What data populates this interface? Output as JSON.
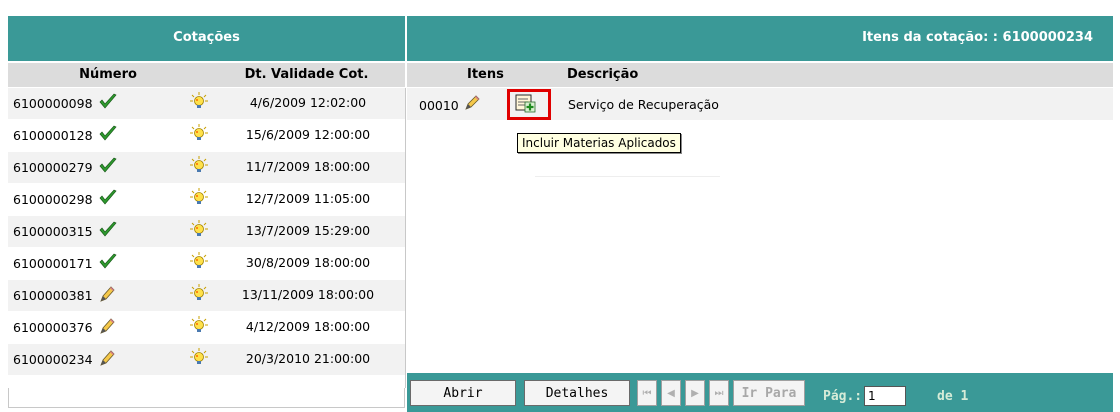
{
  "left_panel": {
    "title": "Cotações",
    "columns": {
      "numero": "Número",
      "validade": "Dt. Validade Cot."
    },
    "rows": [
      {
        "numero": "6100000098",
        "status": "check-icon",
        "validade": "4/6/2009 12:02:00"
      },
      {
        "numero": "6100000128",
        "status": "check-icon",
        "validade": "15/6/2009 12:00:00"
      },
      {
        "numero": "6100000279",
        "status": "check-icon",
        "validade": "11/7/2009 18:00:00"
      },
      {
        "numero": "6100000298",
        "status": "check-icon",
        "validade": "12/7/2009 11:05:00"
      },
      {
        "numero": "6100000315",
        "status": "check-icon",
        "validade": "13/7/2009 15:29:00"
      },
      {
        "numero": "6100000171",
        "status": "check-icon",
        "validade": "30/8/2009 18:00:00"
      },
      {
        "numero": "6100000381",
        "status": "pencil-icon",
        "validade": "13/11/2009 18:00:00"
      },
      {
        "numero": "6100000376",
        "status": "pencil-icon",
        "validade": "4/12/2009 18:00:00"
      },
      {
        "numero": "6100000234",
        "status": "pencil-icon",
        "validade": "20/3/2010 21:00:00"
      }
    ]
  },
  "right_panel": {
    "title": "Itens da cotação: : 6100000234",
    "columns": {
      "itens": "Itens",
      "descricao": "Descrição"
    },
    "items": [
      {
        "item": "00010",
        "descricao": "Serviço de Recuperação"
      }
    ],
    "tooltip": "Incluir Materias Aplicados",
    "highlight_color": "#e00000"
  },
  "footer": {
    "abrir": "Abrir",
    "detalhes": "Detalhes",
    "nav_first": "⏮",
    "nav_prev": "◀",
    "nav_next": "▶",
    "nav_last": "⏭",
    "ir_para": "Ir Para",
    "pag_label": "Pág.:",
    "pag_value": "1",
    "de_label": "de 1"
  },
  "colors": {
    "header_bg": "#3a9997",
    "column_header_bg": "#dcdcdc",
    "row_alt_bg": "#f2f2f2"
  }
}
